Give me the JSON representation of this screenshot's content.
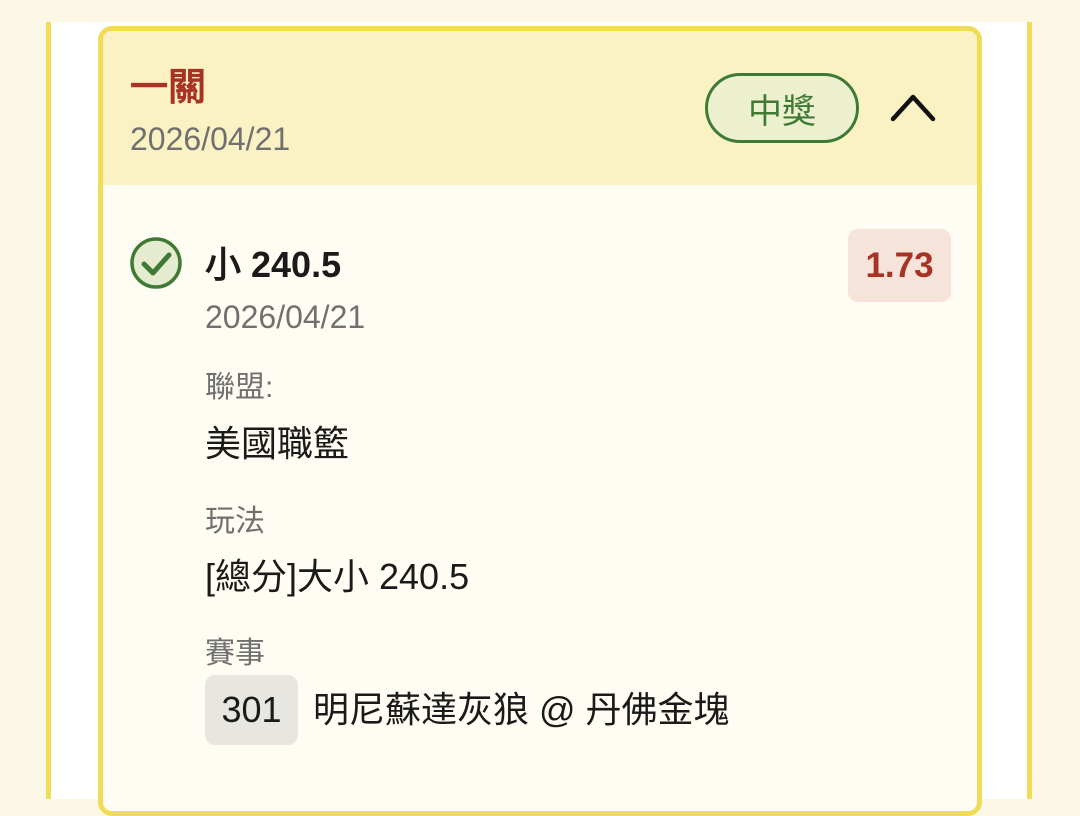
{
  "ticket": {
    "bet_type": "一關",
    "date": "2026/04/21",
    "status": "中獎"
  },
  "selection": {
    "title": "小 240.5",
    "date": "2026/04/21",
    "odds": "1.73",
    "league_label": "聯盟:",
    "league_value": "美國職籃",
    "play_label": "玩法",
    "play_value": "[總分]大小 240.5",
    "event_label": "賽事",
    "event_number": "301",
    "event_teams": "明尼蘇達灰狼 @ 丹佛金塊"
  },
  "colors": {
    "accent_red": "#a83223",
    "win_green": "#3f7a34",
    "border_yellow": "#f1dc57"
  },
  "icons": {
    "status_check": "check-circle-icon",
    "collapse": "chevron-up-icon"
  }
}
